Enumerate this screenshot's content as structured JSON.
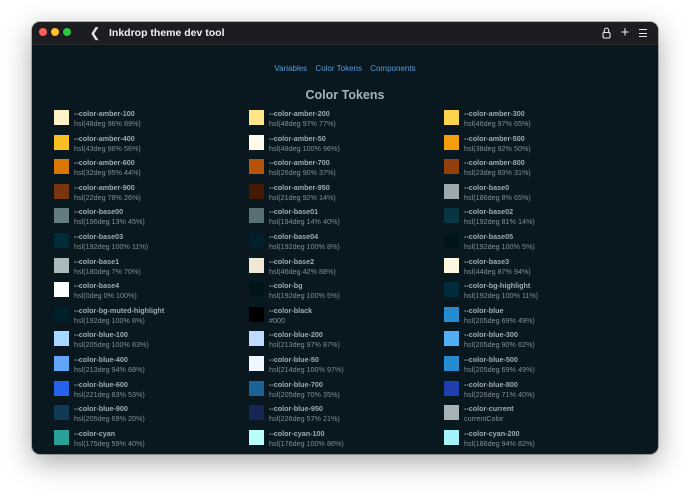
{
  "window": {
    "title": "Inkdrop theme dev tool"
  },
  "nav": {
    "items": [
      "Variables",
      "Color Tokens",
      "Components"
    ]
  },
  "page": {
    "heading": "Color Tokens"
  },
  "tokens": [
    {
      "name": "--color-amber-100",
      "value": "hsl(48deg 96% 89%)",
      "color": "#fef3c7"
    },
    {
      "name": "--color-amber-200",
      "value": "hsl(48deg 97% 77%)",
      "color": "#fde68a"
    },
    {
      "name": "--color-amber-300",
      "value": "hsl(46deg 97% 65%)",
      "color": "#fcd34d"
    },
    {
      "name": "--color-amber-400",
      "value": "hsl(43deg 96% 56%)",
      "color": "#fbbf24"
    },
    {
      "name": "--color-amber-50",
      "value": "hsl(48deg 100% 96%)",
      "color": "#fffbeb"
    },
    {
      "name": "--color-amber-500",
      "value": "hsl(38deg 92% 50%)",
      "color": "#f59e0b"
    },
    {
      "name": "--color-amber-600",
      "value": "hsl(32deg 95% 44%)",
      "color": "#d97706"
    },
    {
      "name": "--color-amber-700",
      "value": "hsl(26deg 90% 37%)",
      "color": "#b45309"
    },
    {
      "name": "--color-amber-800",
      "value": "hsl(23deg 83% 31%)",
      "color": "#92400e"
    },
    {
      "name": "--color-amber-900",
      "value": "hsl(22deg 78% 26%)",
      "color": "#78350f"
    },
    {
      "name": "--color-amber-950",
      "value": "hsl(21deg 92% 14%)",
      "color": "#451a03"
    },
    {
      "name": "--color-base0",
      "value": "hsl(186deg 8% 65%)",
      "color": "#9fa9ab"
    },
    {
      "name": "--color-base00",
      "value": "hsl(196deg 13% 45%)",
      "color": "#647b82"
    },
    {
      "name": "--color-base01",
      "value": "hsl(194deg 14% 40%)",
      "color": "#586f75"
    },
    {
      "name": "--color-base02",
      "value": "hsl(192deg 81% 14%)",
      "color": "#073642"
    },
    {
      "name": "--color-base03",
      "value": "hsl(192deg 100% 11%)",
      "color": "#002b38"
    },
    {
      "name": "--color-base04",
      "value": "hsl(192deg 100% 8%)",
      "color": "#002029"
    },
    {
      "name": "--color-base05",
      "value": "hsl(192deg 100% 5%)",
      "color": "#00141a"
    },
    {
      "name": "--color-base1",
      "value": "hsl(180deg 7% 70%)",
      "color": "#abbaba"
    },
    {
      "name": "--color-base2",
      "value": "hsl(46deg 42% 88%)",
      "color": "#eee8d5"
    },
    {
      "name": "--color-base3",
      "value": "hsl(44deg 87% 94%)",
      "color": "#fdf6e3"
    },
    {
      "name": "--color-base4",
      "value": "hsl(0deg 0% 100%)",
      "color": "#ffffff"
    },
    {
      "name": "--color-bg",
      "value": "hsl(192deg 100% 5%)",
      "color": "#00141a"
    },
    {
      "name": "--color-bg-highlight",
      "value": "hsl(192deg 100% 11%)",
      "color": "#002b38"
    },
    {
      "name": "--color-bg-muted-highlight",
      "value": "hsl(192deg 100% 8%)",
      "color": "#002029"
    },
    {
      "name": "--color-black",
      "value": "#000",
      "color": "#000000"
    },
    {
      "name": "--color-blue",
      "value": "hsl(205deg 69% 49%)",
      "color": "#268bd2"
    },
    {
      "name": "--color-blue-100",
      "value": "hsl(205deg 100% 83%)",
      "color": "#a8d8ff"
    },
    {
      "name": "--color-blue-200",
      "value": "hsl(213deg 97% 87%)",
      "color": "#bfdbfe"
    },
    {
      "name": "--color-blue-300",
      "value": "hsl(205deg 90% 62%)",
      "color": "#52aef5"
    },
    {
      "name": "--color-blue-400",
      "value": "hsl(213deg 94% 68%)",
      "color": "#60a5fa"
    },
    {
      "name": "--color-blue-50",
      "value": "hsl(214deg 100% 97%)",
      "color": "#eff6ff"
    },
    {
      "name": "--color-blue-500",
      "value": "hsl(205deg 69% 49%)",
      "color": "#268bd2"
    },
    {
      "name": "--color-blue-600",
      "value": "hsl(221deg 83% 53%)",
      "color": "#2563eb"
    },
    {
      "name": "--color-blue-700",
      "value": "hsl(205deg 70% 35%)",
      "color": "#1b6397"
    },
    {
      "name": "--color-blue-800",
      "value": "hsl(226deg 71% 40%)",
      "color": "#1e40af"
    },
    {
      "name": "--color-blue-900",
      "value": "hsl(205deg 69% 20%)",
      "color": "#103956"
    },
    {
      "name": "--color-blue-950",
      "value": "hsl(226deg 57% 21%)",
      "color": "#172554"
    },
    {
      "name": "--color-current",
      "value": "currentColor",
      "color": "#a8b3b8"
    },
    {
      "name": "--color-cyan",
      "value": "hsl(175deg 59% 40%)",
      "color": "#2aa198"
    },
    {
      "name": "--color-cyan-100",
      "value": "hsl(176deg 100% 86%)",
      "color": "#b8fff9"
    },
    {
      "name": "--color-cyan-200",
      "value": "hsl(186deg 94% 82%)",
      "color": "#a5f3fc"
    }
  ]
}
